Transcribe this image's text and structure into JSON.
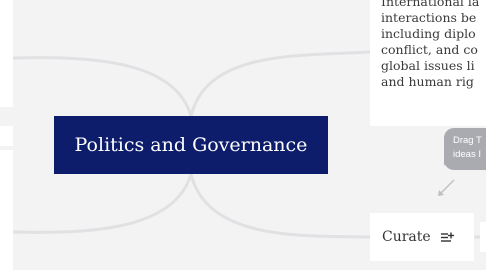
{
  "central_topic": {
    "label": "Politics and Governance"
  },
  "topic_note": {
    "text": "International la\ninteractions be\nincluding diplo\nconflict, and co\nglobal issues li\nand human rig"
  },
  "drag_hint": {
    "text": "Drag T\nideas I"
  },
  "curate_node": {
    "label": "Curate",
    "icon": "sort-list-icon"
  },
  "colors": {
    "canvas_background": "#f3f3f4",
    "central_node": "#0d1d6b",
    "connector": "#e1e1e4",
    "tooltip": "#a9abb0",
    "card": "#ffffff"
  }
}
